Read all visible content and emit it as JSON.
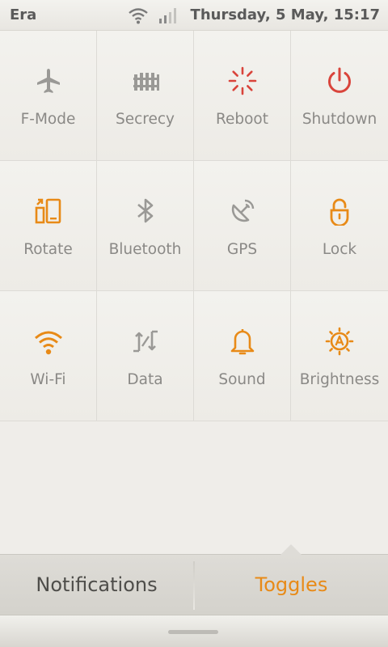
{
  "status": {
    "carrier": "Era",
    "datetime": "Thursday, 5 May, 15:17",
    "icons": [
      "wifi-icon",
      "signal-icon"
    ]
  },
  "colors": {
    "active": "#e88a17",
    "inactive": "#9a9996",
    "alert": "#d9443b"
  },
  "toggles": [
    {
      "label": "F-Mode",
      "icon": "airplane-icon",
      "state": "off"
    },
    {
      "label": "Secrecy",
      "icon": "fence-icon",
      "state": "off"
    },
    {
      "label": "Reboot",
      "icon": "reboot-icon",
      "state": "action"
    },
    {
      "label": "Shutdown",
      "icon": "power-icon",
      "state": "action"
    },
    {
      "label": "Rotate",
      "icon": "rotate-icon",
      "state": "on"
    },
    {
      "label": "Bluetooth",
      "icon": "bluetooth-icon",
      "state": "off"
    },
    {
      "label": "GPS",
      "icon": "gps-icon",
      "state": "off"
    },
    {
      "label": "Lock",
      "icon": "lock-icon",
      "state": "on"
    },
    {
      "label": "Wi-Fi",
      "icon": "wifi-icon",
      "state": "on"
    },
    {
      "label": "Data",
      "icon": "data-icon",
      "state": "off"
    },
    {
      "label": "Sound",
      "icon": "bell-icon",
      "state": "on"
    },
    {
      "label": "Brightness",
      "icon": "brightness-icon",
      "state": "on"
    }
  ],
  "tabs": {
    "notifications": "Notifications",
    "toggles": "Toggles",
    "selected": "toggles"
  }
}
